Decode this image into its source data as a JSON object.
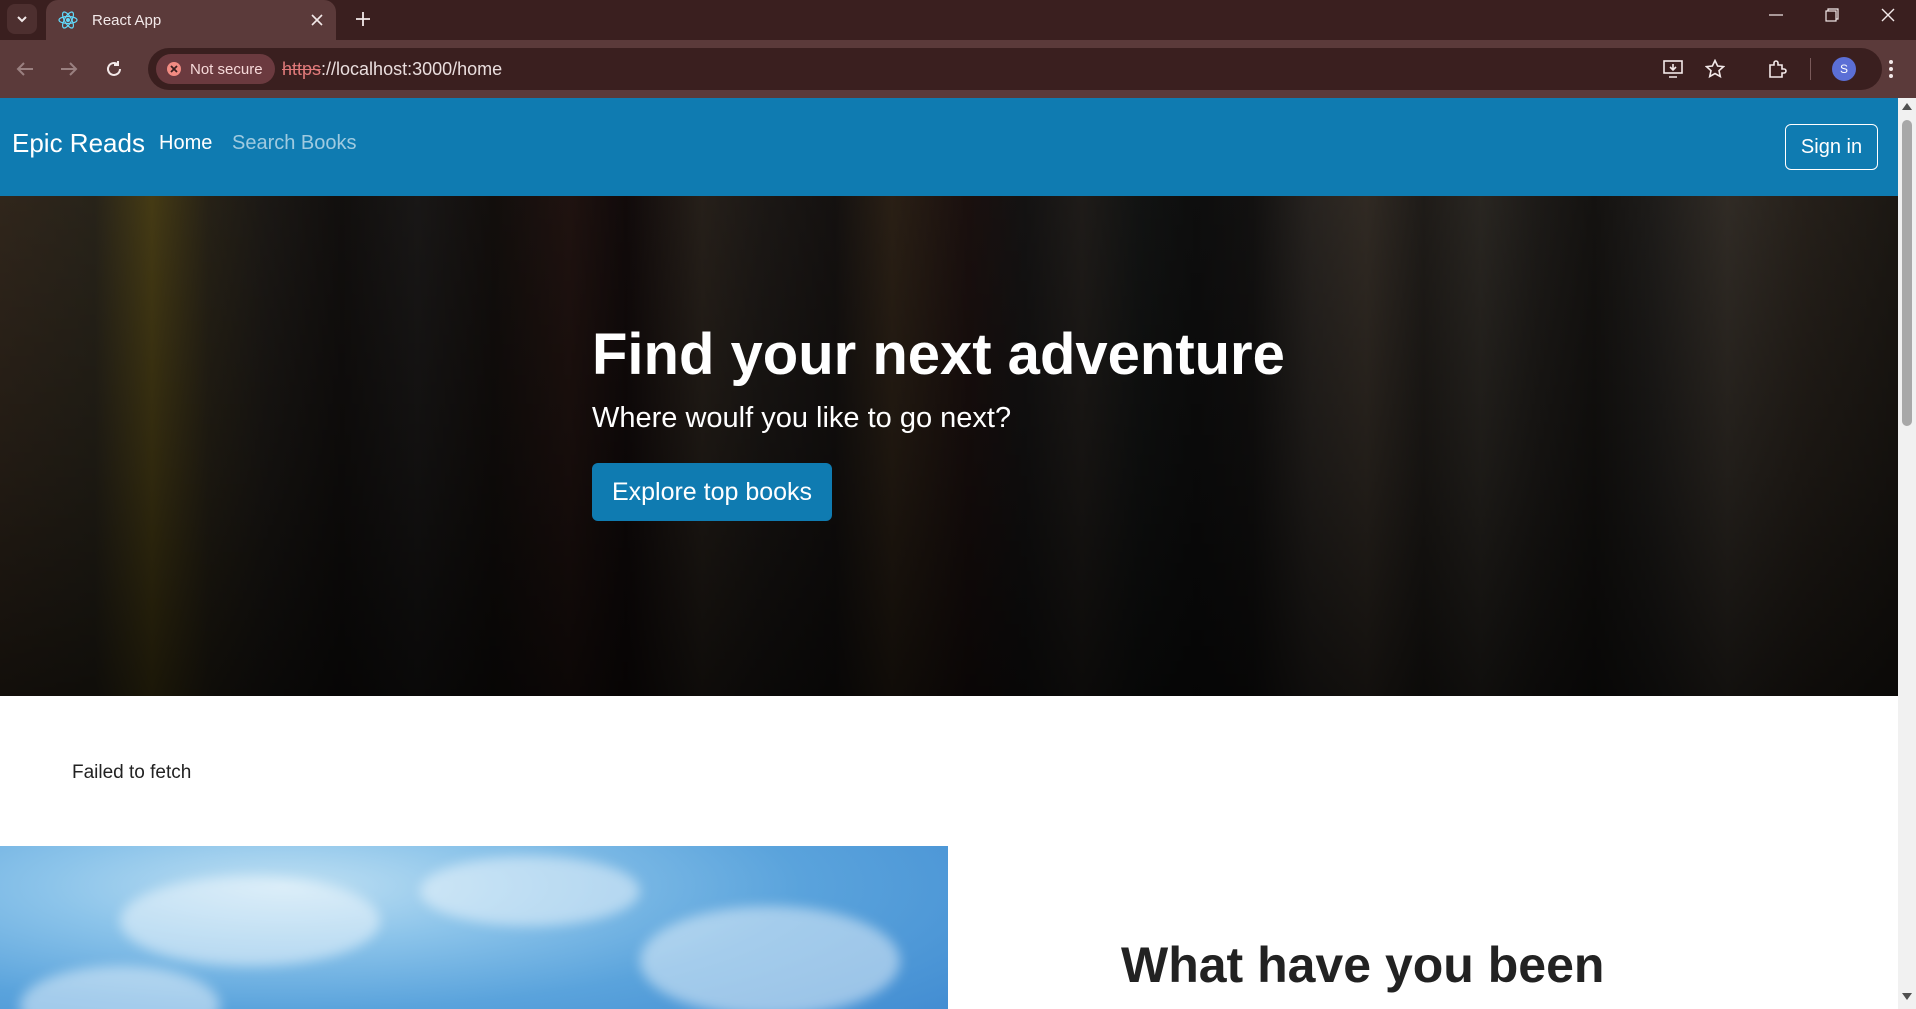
{
  "browser": {
    "tab_title": "React App",
    "security_label": "Not secure",
    "url_scheme": "https",
    "url_rest": "://localhost:3000/home",
    "profile_initial": "S"
  },
  "navbar": {
    "brand": "Epic Reads",
    "links": [
      {
        "label": "Home",
        "active": true
      },
      {
        "label": "Search Books",
        "active": false
      }
    ],
    "signin_label": "Sign in",
    "color": "#0f7bb1"
  },
  "hero": {
    "title": "Find your next adventure",
    "subtitle": "Where woulf you like to go next?",
    "button_label": "Explore top books"
  },
  "content": {
    "error_message": "Failed to fetch",
    "section_heading": "What have you been"
  },
  "icons": [
    "tab-search-icon",
    "react-icon",
    "close-icon",
    "plus-icon",
    "minimize-icon",
    "restore-icon",
    "back-icon",
    "forward-icon",
    "reload-icon",
    "error-icon",
    "install-icon",
    "star-icon",
    "extensions-icon",
    "more-icon"
  ]
}
